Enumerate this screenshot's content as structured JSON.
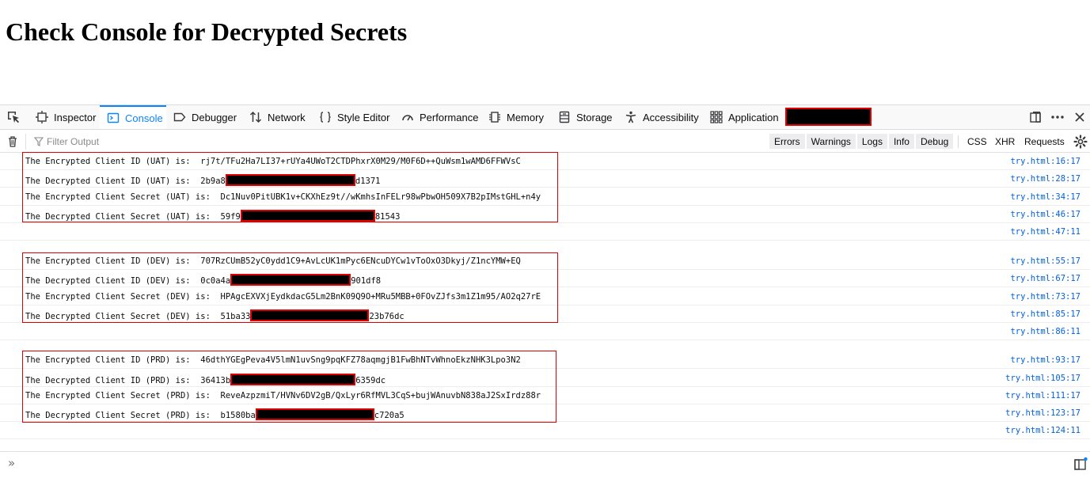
{
  "page": {
    "heading": "Check Console for Decrypted Secrets"
  },
  "tabs": [
    {
      "label": "Inspector",
      "icon": "inspector-icon"
    },
    {
      "label": "Console",
      "icon": "console-icon",
      "selected": true
    },
    {
      "label": "Debugger",
      "icon": "debugger-icon"
    },
    {
      "label": "Network",
      "icon": "network-icon"
    },
    {
      "label": "Style Editor",
      "icon": "style-editor-icon"
    },
    {
      "label": "Performance",
      "icon": "performance-icon"
    },
    {
      "label": "Memory",
      "icon": "memory-icon"
    },
    {
      "label": "Storage",
      "icon": "storage-icon"
    },
    {
      "label": "Accessibility",
      "icon": "accessibility-icon"
    },
    {
      "label": "Application",
      "icon": "application-icon"
    }
  ],
  "console_toolbar": {
    "filter_placeholder": "Filter Output",
    "levels": [
      "Errors",
      "Warnings",
      "Logs",
      "Info",
      "Debug"
    ],
    "net": [
      "CSS",
      "XHR",
      "Requests"
    ]
  },
  "messages": [
    {
      "pre": "The Encrypted Client ID (UAT) is:  rj7t/TFu2Ha7LI37+rUYa4UWoT2CTDPhxrX0M29/M0F6D++QuWsm1wAMD6FFWVsC",
      "post": "",
      "location": "try.html:16:17"
    },
    {
      "pre": "The Decrypted Client ID (UAT) is:  2b9a8",
      "post": "d1371",
      "location": "try.html:28:17"
    },
    {
      "pre": "The Encrypted Client Secret (UAT) is:  Dc1Nuv0PitUBK1v+CKXhEz9t//wKmhsInFELr98wPbwOH509X7B2pIMstGHL+n4y",
      "post": "",
      "location": "try.html:34:17"
    },
    {
      "pre": "The Decrypted Client Secret (UAT) is:  59f9",
      "post": "81543",
      "location": "try.html:46:17"
    },
    {
      "pre": "",
      "post": "",
      "location": "try.html:47:11"
    },
    {
      "pre": "The Encrypted Client ID (DEV) is:  707RzCUmB52yC0ydd1C9+AvLcUK1mPyc6ENcuDYCw1vToOxO3Dkyj/Z1ncYMW+EQ",
      "post": "",
      "location": "try.html:55:17"
    },
    {
      "pre": "The Decrypted Client ID (DEV) is:  0c0a4a",
      "post": "901df8",
      "location": "try.html:67:17"
    },
    {
      "pre": "The Encrypted Client Secret (DEV) is:  HPAgcEXVXjEydkdacG5Lm2BnK09Q9O+MRu5MBB+0FOvZJfs3m1Z1m95/AO2q27rE",
      "post": "",
      "location": "try.html:73:17"
    },
    {
      "pre": "The Decrypted Client Secret (DEV) is:  51ba33",
      "post": "23b76dc",
      "location": "try.html:85:17"
    },
    {
      "pre": "",
      "post": "",
      "location": "try.html:86:11"
    },
    {
      "pre": "The Encrypted Client ID (PRD) is:  46dthYGEgPeva4V5lmN1uvSng9pqKFZ78aqmgjB1FwBhNTvWhnoEkzNHK3Lpo3N2",
      "post": "",
      "location": "try.html:93:17"
    },
    {
      "pre": "The Decrypted Client ID (PRD) is:  36413b",
      "post": "6359dc",
      "location": "try.html:105:17"
    },
    {
      "pre": "The Encrypted Client Secret (PRD) is:  ReveAzpzmiT/HVNv6DV2gB/QxLyr6RfMVL3CqS+bujWAnuvbN838aJ2SxIrdz88r",
      "post": "",
      "location": "try.html:111:17"
    },
    {
      "pre": "The Decrypted Client Secret (PRD) is:  b1580ba",
      "post": "c720a5",
      "location": "try.html:123:17"
    },
    {
      "pre": "",
      "post": "",
      "location": "try.html:124:11"
    }
  ],
  "colors": {
    "accent": "#0a84ff",
    "link": "#0060df",
    "redaction_border": "#e00000"
  }
}
